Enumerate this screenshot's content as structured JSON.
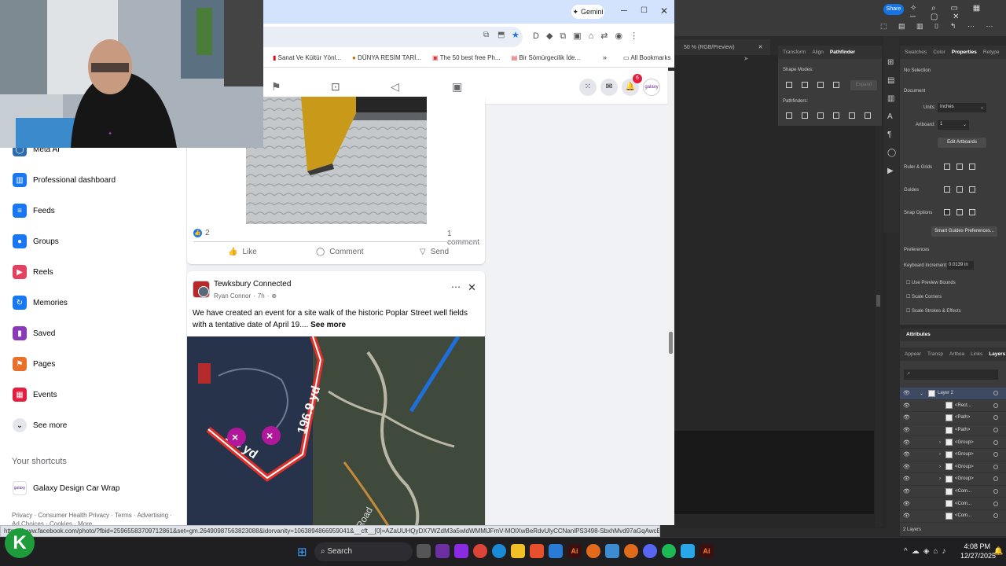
{
  "chrome": {
    "gemini_label": "Gemini",
    "bookmarks": [
      {
        "label": "Sanat Ve Kültür Yönl..."
      },
      {
        "label": "DÜNYA RESİM TARİ..."
      },
      {
        "label": "The 50 best free Ph..."
      },
      {
        "label": "Bir Sömürgecilik İde..."
      }
    ],
    "all_bookmarks": "All Bookmarks",
    "status_url": "https://www.facebook.com/photo/?fbid=25965583709712861&set=gm.26490987563823088&idorvanity=1063894866959041&__cft__[0]=AZaUUHQyDX7WZdM3a5wldWMMlJFmV-MOlXwBeRdvUlyCCNanlPS3498-SbxhMvd97aGqAwcE42XaRBwR_Arz2dOinWnA04mJXA3FnTkc..."
  },
  "facebook": {
    "notification_count": "6",
    "sidebar": [
      {
        "label": "Meta AI",
        "icon": "meta-ai-icon"
      },
      {
        "label": "Professional dashboard",
        "icon": "dashboard-icon"
      },
      {
        "label": "Feeds",
        "icon": "feeds-icon"
      },
      {
        "label": "Groups",
        "icon": "groups-icon"
      },
      {
        "label": "Reels",
        "icon": "reels-icon"
      },
      {
        "label": "Memories",
        "icon": "memories-icon"
      },
      {
        "label": "Saved",
        "icon": "saved-icon"
      },
      {
        "label": "Pages",
        "icon": "pages-icon"
      },
      {
        "label": "Events",
        "icon": "events-icon"
      },
      {
        "label": "See more",
        "icon": "chevron-down-icon"
      }
    ],
    "shortcuts_title": "Your shortcuts",
    "shortcut": "Galaxy Design Car Wrap",
    "footer": "Privacy · Consumer Health Privacy · Terms · Advertising ·",
    "footer2": "Ad Choices · Cookies · More",
    "post1": {
      "reactions": "2",
      "comments": "1 comment",
      "like": "Like",
      "comment": "Comment",
      "send": "Send"
    },
    "post2": {
      "group": "Tewksbury Connected",
      "author": "Ryan Connor",
      "time": "7h",
      "text": "We have created an event for a site walk of the historic Poplar Street well fields with a tentative date of April 19....",
      "see_more": "See more",
      "map_label_1": "196.9 yd",
      "map_label_2": "1 4 yd",
      "map_road": "Road"
    }
  },
  "illustrator": {
    "share": "Share",
    "doc_tab": "50 % (RGB/Preview)",
    "pathfinder_tabs": [
      "Transform",
      "Align",
      "Pathfinder"
    ],
    "shape_modes": "Shape Modes:",
    "expand": "Expand",
    "pathfinders": "Pathfinders:",
    "props_tabs": [
      "Swatches",
      "Color",
      "Properties",
      "Retype"
    ],
    "no_selection": "No Selection",
    "document": "Document",
    "units_label": "Units:",
    "units_value": "Inches",
    "artboard_label": "Artboard:",
    "artboard_value": "1",
    "edit_artboards": "Edit Artboards",
    "ruler_grids": "Ruler & Grids",
    "guides": "Guides",
    "snap_options": "Snap Options",
    "smart_guides": "Smart Guides Preferences...",
    "preferences": "Preferences",
    "keyboard_increment": "Keyboard Increment:",
    "keyboard_value": "0.0139 in",
    "use_preview_bounds": "Use Preview Bounds",
    "scale_corners": "Scale Corners",
    "scale_strokes": "Scale Strokes & Effects",
    "attributes": "Attributes",
    "layers_tabs": [
      "Appear",
      "Transp",
      "Artboa",
      "Links",
      "Layers"
    ],
    "layers": [
      "Layer 2",
      "<Rect...",
      "<Path>",
      "<Path>",
      "<Group>",
      "<Group>",
      "<Group>",
      "<Group>",
      "<Com...",
      "<Com...",
      "<Com..."
    ],
    "layers_count": "2 Layers"
  },
  "taskbar": {
    "search": "Search",
    "time": "4:08 PM",
    "date": "12/27/2025"
  }
}
